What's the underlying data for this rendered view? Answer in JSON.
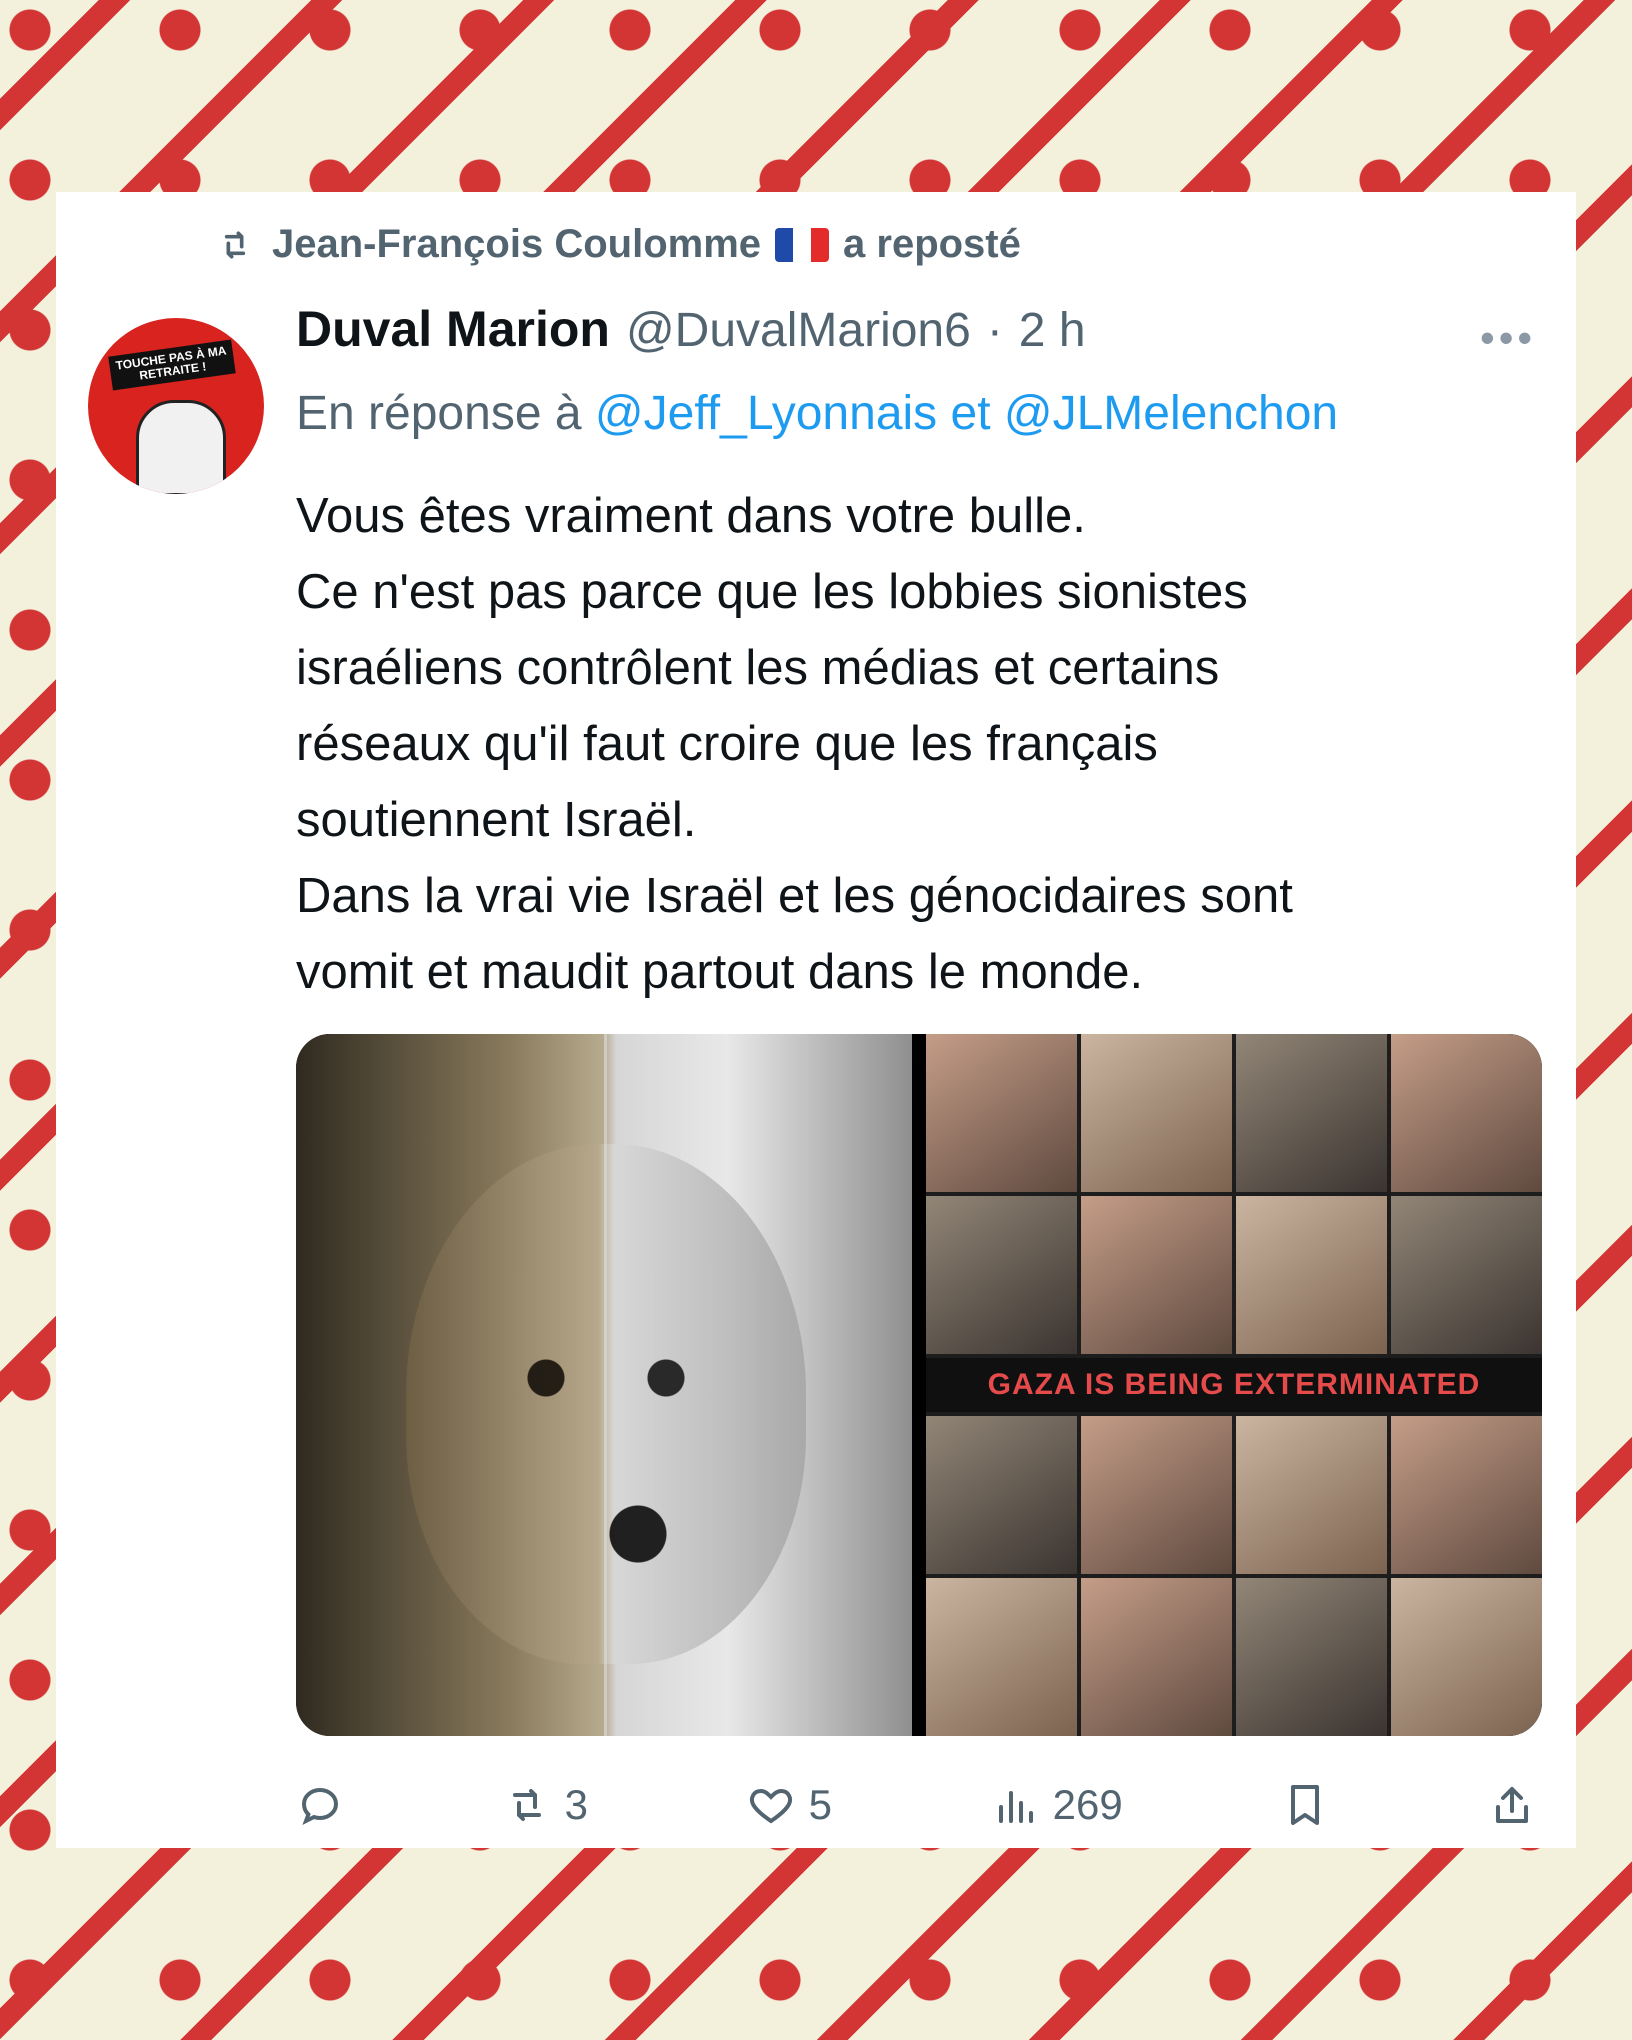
{
  "repost": {
    "label": "Jean-François Coulomme",
    "suffix": "a reposté"
  },
  "tweet": {
    "author": "Duval Marion",
    "handle": "@DuvalMarion6",
    "dot": "·",
    "time": "2 h",
    "reply_prefix": "En réponse à",
    "reply_mentions": "@Jeff_Lyonnais et @JLMelenchon",
    "text_lines": [
      "Vous êtes vraiment dans votre bulle.",
      "Ce n'est pas parce que les lobbies sionistes",
      "israéliens contrôlent les médias et certains",
      "réseaux qu'il faut croire que les français",
      "soutiennent Israël.",
      "Dans la vrai vie Israël et les génocidaires sont",
      "vomit et maudit partout dans le monde."
    ],
    "avatar_text": "TOUCHE PAS À MA RETRAITE !",
    "media": {
      "banner": "GAZA IS BEING EXTERMINATED"
    },
    "stats": {
      "retweets": "3",
      "likes": "5",
      "views": "269"
    }
  },
  "icons": {
    "more": "more-icon",
    "reply": "reply-icon",
    "retweet": "retweet-icon",
    "like": "heart-icon",
    "views": "views-icon",
    "bookmark": "bookmark-icon",
    "share": "share-icon"
  }
}
